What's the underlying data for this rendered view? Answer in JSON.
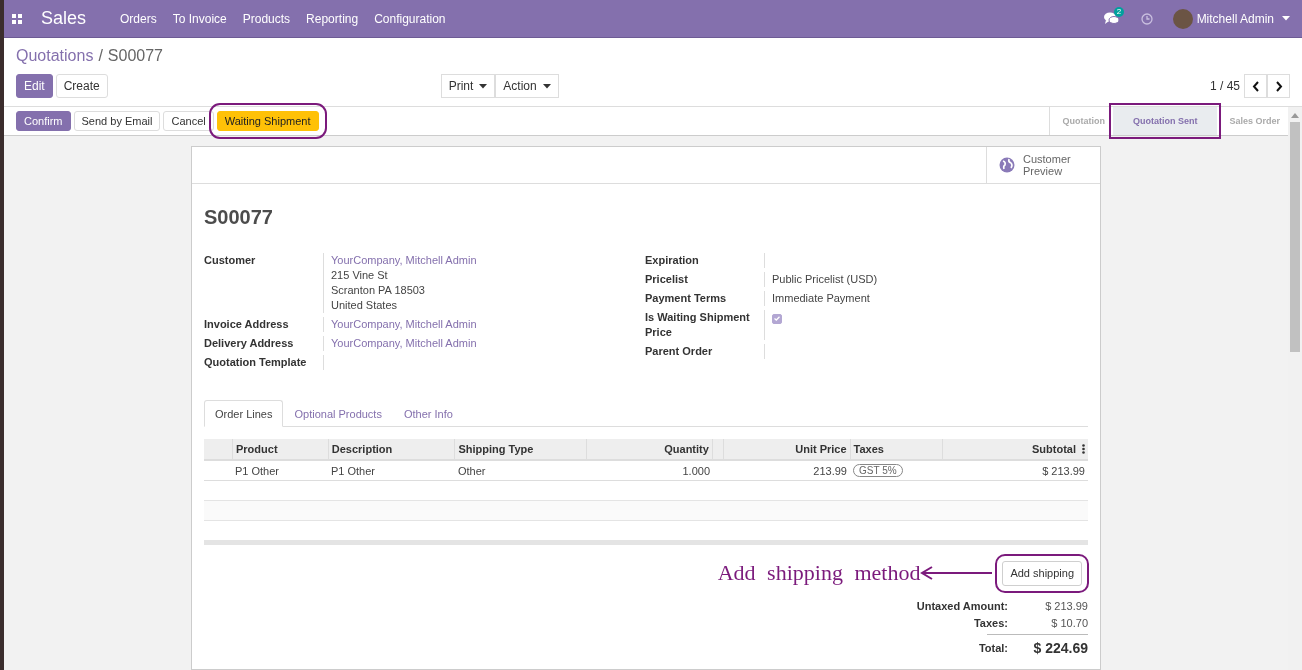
{
  "navbar": {
    "app_title": "Sales",
    "menu": [
      "Orders",
      "To Invoice",
      "Products",
      "Reporting",
      "Configuration"
    ],
    "messages_badge": "2",
    "user": "Mitchell Admin"
  },
  "breadcrumb": {
    "parent": "Quotations",
    "separator": "/",
    "current": "S00077"
  },
  "control_buttons": [
    {
      "label": "Edit",
      "kind": "primary"
    },
    {
      "label": "Create",
      "kind": "secondary"
    }
  ],
  "dropdowns": [
    "Print",
    "Action"
  ],
  "pager": "1 / 45",
  "status_buttons": [
    {
      "label": "Confirm",
      "kind": "primary",
      "highlighted": false
    },
    {
      "label": "Send by Email",
      "kind": "secondary",
      "highlighted": false
    },
    {
      "label": "Cancel",
      "kind": "secondary",
      "highlighted": false
    },
    {
      "label": "Waiting Shipment",
      "kind": "warning",
      "highlighted": true
    }
  ],
  "stages": [
    {
      "label": "Quotation",
      "selected": false,
      "highlighted": false
    },
    {
      "label": "Quotation Sent",
      "selected": true,
      "highlighted": true
    },
    {
      "label": "Sales Order",
      "selected": false,
      "highlighted": false
    }
  ],
  "sheet": {
    "customer_preview": "Customer Preview",
    "name": "S00077",
    "left_fields": [
      {
        "label": "Customer",
        "kind": "link",
        "values": [
          "YourCompany, Mitchell Admin",
          "215 Vine St",
          "Scranton PA 18503",
          "United States"
        ]
      },
      {
        "label": "Invoice Address",
        "kind": "link",
        "values": [
          "YourCompany, Mitchell Admin"
        ]
      },
      {
        "label": "Delivery Address",
        "kind": "link",
        "values": [
          "YourCompany, Mitchell Admin"
        ]
      },
      {
        "label": "Quotation Template",
        "kind": "text"
      }
    ],
    "right_fields": [
      {
        "label": "Expiration",
        "kind": "text"
      },
      {
        "label": "Pricelist",
        "kind": "text",
        "values": [
          "Public Pricelist (USD)"
        ]
      },
      {
        "label": "Payment Terms",
        "kind": "text",
        "values": [
          "Immediate Payment"
        ]
      },
      {
        "label": "Is Waiting Shipment Price",
        "kind": "checkbox",
        "checked": true
      },
      {
        "label": "Parent Order",
        "kind": "text"
      }
    ],
    "tabs": [
      {
        "label": "Order Lines",
        "selected": true
      },
      {
        "label": "Optional Products",
        "selected": false
      },
      {
        "label": "Other Info",
        "selected": false
      }
    ],
    "table": {
      "columns": [
        "Product",
        "Description",
        "Shipping Type",
        "Quantity",
        "Unit Price",
        "Taxes",
        "Subtotal"
      ],
      "rows": [
        {
          "product": "P1 Other",
          "description": "P1 Other",
          "shipping_type": "Other",
          "quantity": "1.000",
          "unit_price": "213.99",
          "taxes": [
            "GST 5%"
          ],
          "subtotal": "$ 213.99"
        }
      ]
    },
    "add_shipping": {
      "label": "Add shipping",
      "highlighted": true
    },
    "annotation": "Add shipping method",
    "totals": [
      {
        "label": "Untaxed Amount:",
        "value": "$ 213.99"
      },
      {
        "label": "Taxes:",
        "value": "$ 10.70"
      }
    ],
    "total": {
      "label": "Total:",
      "value": "$ 224.69"
    }
  }
}
